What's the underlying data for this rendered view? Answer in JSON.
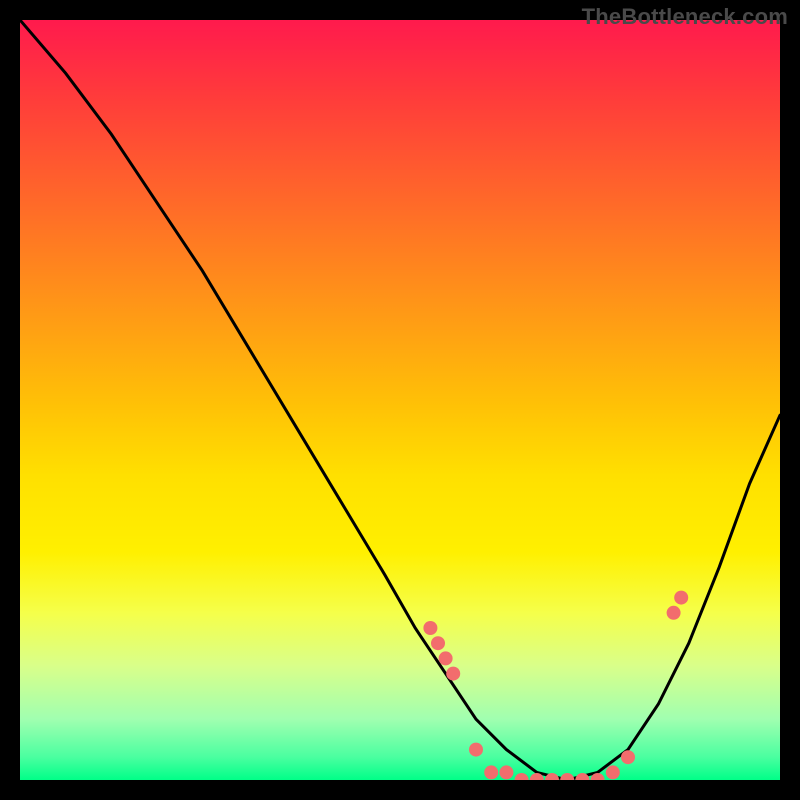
{
  "watermark": "TheBottleneck.com",
  "chart_data": {
    "type": "line",
    "title": "",
    "xlabel": "",
    "ylabel": "",
    "xlim": [
      0,
      100
    ],
    "ylim": [
      0,
      100
    ],
    "series": [
      {
        "name": "bottleneck-curve",
        "x": [
          0,
          6,
          12,
          18,
          24,
          30,
          36,
          42,
          48,
          52,
          56,
          60,
          64,
          68,
          72,
          76,
          80,
          84,
          88,
          92,
          96,
          100
        ],
        "y": [
          100,
          93,
          85,
          76,
          67,
          57,
          47,
          37,
          27,
          20,
          14,
          8,
          4,
          1,
          0,
          1,
          4,
          10,
          18,
          28,
          39,
          48
        ]
      }
    ],
    "scatter": {
      "name": "sample-points",
      "x": [
        54,
        55,
        56,
        57,
        60,
        62,
        64,
        66,
        68,
        70,
        72,
        74,
        76,
        78,
        80,
        86,
        87
      ],
      "y": [
        20,
        18,
        16,
        14,
        4,
        1,
        1,
        0,
        0,
        0,
        0,
        0,
        0,
        1,
        3,
        22,
        24
      ]
    },
    "colors": {
      "curve": "#000000",
      "dots": "#f26d6d",
      "gradient_top": "#ff1a4d",
      "gradient_bottom": "#00ff88"
    }
  }
}
